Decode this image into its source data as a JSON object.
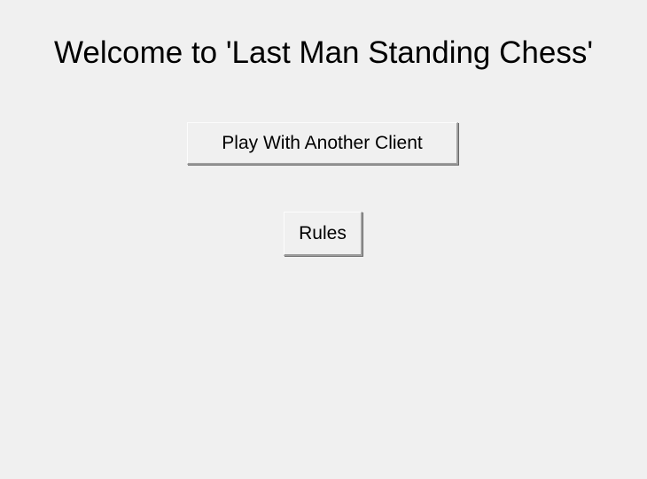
{
  "main": {
    "title": "Welcome to 'Last Man Standing Chess'",
    "buttons": {
      "play_label": "Play With Another Client",
      "rules_label": "Rules"
    }
  },
  "colors": {
    "background": "#f0f0f0",
    "text": "#000000"
  }
}
